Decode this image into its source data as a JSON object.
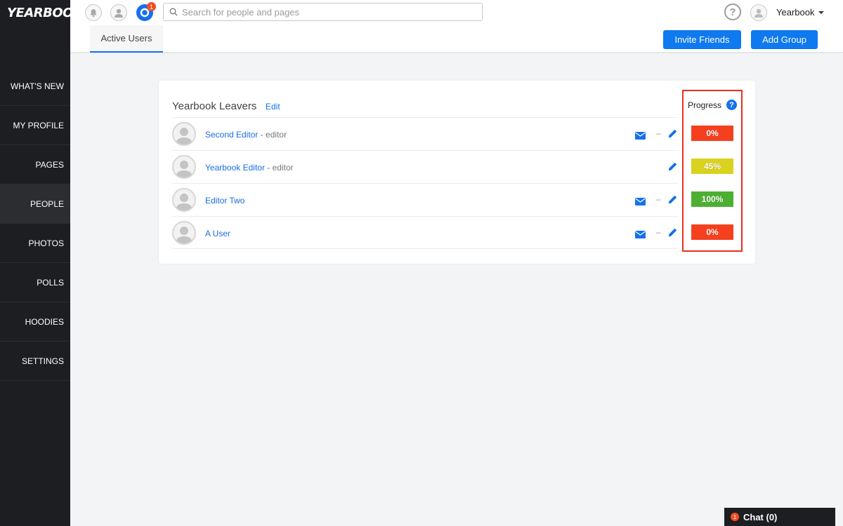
{
  "app": {
    "logo_text": "YEARBOOK"
  },
  "sidebar": {
    "items": [
      {
        "label": "WHAT'S NEW",
        "active": false
      },
      {
        "label": "MY PROFILE",
        "active": false
      },
      {
        "label": "PAGES",
        "active": false
      },
      {
        "label": "PEOPLE",
        "active": true
      },
      {
        "label": "PHOTOS",
        "active": false
      },
      {
        "label": "POLLS",
        "active": false
      },
      {
        "label": "HOODIES",
        "active": false
      },
      {
        "label": "SETTINGS",
        "active": false
      }
    ]
  },
  "topbar": {
    "notifications_badge": "1",
    "search_placeholder": "Search for people and pages",
    "help_symbol": "?",
    "user_name": "Yearbook"
  },
  "subbar": {
    "active_tab": "Active Users",
    "invite_button": "Invite Friends",
    "add_group_button": "Add Group"
  },
  "group": {
    "title": "Yearbook Leavers",
    "edit_label": "Edit",
    "progress_header": "Progress",
    "members": [
      {
        "name": "Second Editor",
        "role": " - editor",
        "has_mail": true,
        "progress": "0%",
        "progress_color": "#f5401f"
      },
      {
        "name": "Yearbook Editor",
        "role": " - editor",
        "has_mail": false,
        "progress": "45%",
        "progress_color": "#d9d21f"
      },
      {
        "name": "Editor Two",
        "role": "",
        "has_mail": true,
        "progress": "100%",
        "progress_color": "#4caf32"
      },
      {
        "name": "A User",
        "role": "",
        "has_mail": true,
        "progress": "0%",
        "progress_color": "#f5401f"
      }
    ]
  },
  "chat": {
    "badge": "1",
    "label": "Chat (0)"
  },
  "colors": {
    "accent": "#1570ef",
    "sidebar_bg": "#1d1e22",
    "highlight_border": "#e53020"
  }
}
